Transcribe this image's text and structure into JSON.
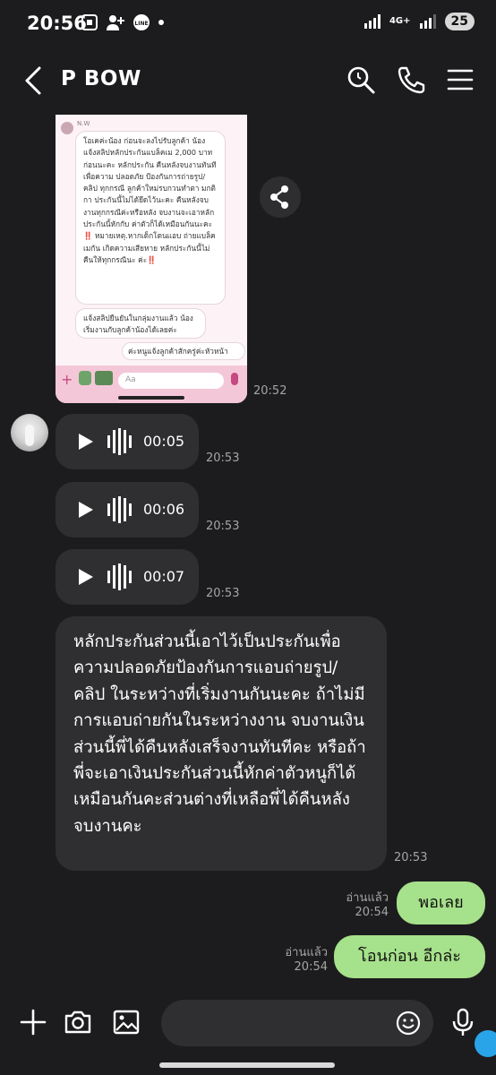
{
  "status_bar": {
    "time": "20:56",
    "network": "4G+",
    "battery": "25"
  },
  "header": {
    "contact_name": "P BOW"
  },
  "image_message": {
    "sender_tag": "N.W",
    "bubble1": "โอเคค่ะน้อง ก่อนจะลงไปรับลูกค้า น้องแจ้งสลิปหลักประกันแบล็คเม 2,000 บาทก่อนนะคะ หลักประกัน คืนหลังจบงานทันที เพื่อความ ปลอดภัย ป้องกันการถ่ายรูป/คลิป ทุกกรณี ลูกค้าใหม่รบกวนทำตา มกติกา ประกันนี้ไม่ได้ยึดไว้นะคะ คืนหลังจบงานทุกกรณีค่ะหรือหลัง จบงานจะเอาหลักประกันนี้หักกับ ค่าตัวก็ได้เหมือนกันนะคะ",
    "bubble1_warning": "‼️ หมายเหตุ.หากเด็กโดนแอบ ถ่ายแบล็คเมกัน เกิดความเสียหาย หลักประกันนี้ไม่คืนให้ทุกกรณีนะ ค่ะ‼️",
    "bubble2": "แจ้งสลิปยืนยันในกลุ่มงานแล้ว น้องเริ่มงานกับลูกค้าน้องได้เลยค่ะ",
    "bubble3": "ค่ะหนูแจ้งลูกค้าสักครู่ค่ะหัวหน้า",
    "input_placeholder": "Aa",
    "time": "20:52"
  },
  "voice_messages": [
    {
      "duration": "00:05",
      "time": "20:53"
    },
    {
      "duration": "00:06",
      "time": "20:53"
    },
    {
      "duration": "00:07",
      "time": "20:53"
    }
  ],
  "text_message": {
    "text": "หลักประกันส่วนนี้เอาไว้เป็นประกันเพื่อความปลอดภัยป้องกันการแอบถ่ายรูป/คลิป ในระหว่างที่เริ่มงานกันนะคะ ถ้าไม่มีการแอบถ่ายกันในระหว่างงาน จบงานเงินส่วนนี้พี่ได้คืนหลังเสร็จงานทันทีคะ หรือถ้าพี่จะเอาเงินประกันส่วนนี้หักค่าตัวหนูก็ได้ เหมือนกันคะส่วนต่างที่เหลือพี่ได้คืนหลังจบงานคะ",
    "time": "20:53"
  },
  "sent_messages": [
    {
      "text": "พอเลย",
      "read": "อ่านแล้ว",
      "time": "20:54"
    },
    {
      "text": "โอนก่อน อีกล่ะ",
      "read": "อ่านแล้ว",
      "time": "20:54"
    }
  ],
  "colors": {
    "background": "#1c1c1e",
    "bubble_incoming": "#2f2f31",
    "bubble_outgoing": "#a6e18b",
    "meta_text": "#a5a5a5"
  },
  "icons": [
    "back-arrow-icon",
    "search-icon",
    "phone-icon",
    "menu-icon",
    "share-icon",
    "play-icon",
    "waveform-icon",
    "plus-icon",
    "camera-icon",
    "image-icon",
    "emoji-icon",
    "microphone-icon"
  ]
}
